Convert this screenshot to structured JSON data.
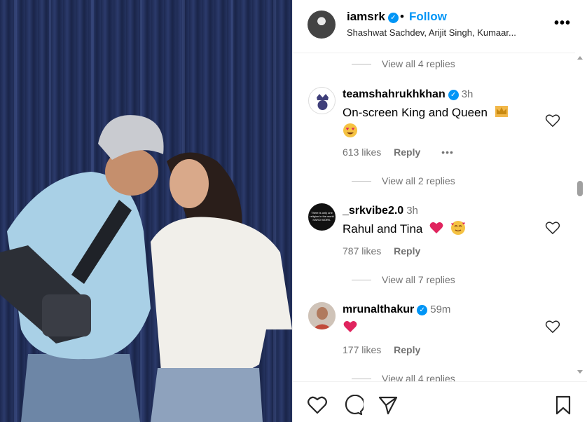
{
  "post": {
    "username": "iamsrk",
    "separator": "•",
    "follow_label": "Follow",
    "audio": "Shashwat Sachdev, Arijit Singh, Kumaar..."
  },
  "comments": [
    {
      "view_replies": "View all 4 replies"
    },
    {
      "username": "teamshahrukhkhan",
      "time": "3h",
      "text": "On-screen King and Queen",
      "likes": "613 likes",
      "reply": "Reply",
      "more": "•••",
      "emojis": [
        "crown",
        "heart-eyes"
      ]
    },
    {
      "view_replies": "View all 2 replies"
    },
    {
      "username": "_srkvibe2.0",
      "time": "3h",
      "text": "Rahul and Tina",
      "likes": "787 likes",
      "reply": "Reply",
      "emojis": [
        "red-heart",
        "smiling-hearts"
      ],
      "avatar_text": "There is only one religion in the world HARD WORK."
    },
    {
      "view_replies": "View all 7 replies"
    },
    {
      "username": "mrunalthakur",
      "time": "59m",
      "text": "",
      "likes": "177 likes",
      "reply": "Reply",
      "emojis": [
        "red-heart"
      ]
    },
    {
      "view_replies": "View all 4 replies"
    }
  ],
  "colors": {
    "accent": "#0095f6",
    "muted": "#737373",
    "heart": "#e0245e"
  },
  "icons": [
    "like-icon",
    "comment-icon",
    "share-icon",
    "save-icon",
    "more-icon",
    "verified-icon"
  ]
}
